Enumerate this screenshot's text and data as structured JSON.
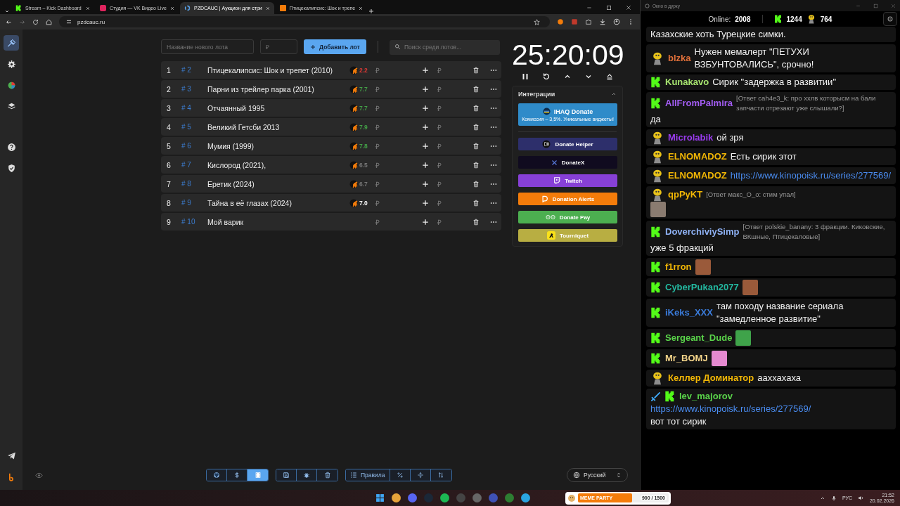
{
  "browser": {
    "tabs": [
      {
        "title": "Stream – Kick Dashboard",
        "kind": "kick",
        "selected": false
      },
      {
        "title": "Студия — VK Видео Live",
        "kind": "vk",
        "selected": false
      },
      {
        "title": "PZDCAUC | Аукцион для стри",
        "kind": "ring",
        "selected": true
      },
      {
        "title": "Птицекалипсис: Шок и трепе",
        "kind": "film",
        "selected": false
      }
    ],
    "address": "pzdcauc.ru"
  },
  "sidebar": {
    "items": [
      {
        "kind": "auction",
        "selected": true
      },
      {
        "kind": "settings",
        "selected": false
      },
      {
        "kind": "chart",
        "selected": false
      },
      {
        "kind": "layers",
        "selected": false
      },
      {
        "kind": "help",
        "selected": false
      },
      {
        "kind": "shield",
        "selected": false
      },
      {
        "kind": "telegram",
        "selected": false
      },
      {
        "kind": "logo",
        "selected": false
      }
    ]
  },
  "lot_form": {
    "name_placeholder": "Название нового лота",
    "amount_placeholder": "₽",
    "add_button": "Добавить лот",
    "search_placeholder": "Поиск среди лотов..."
  },
  "lots": [
    {
      "index": "1",
      "id": "# 2",
      "name": "Птицекалипсис: Шок и трепет (2010)",
      "rating": {
        "text": "2.2",
        "color": "#e53935"
      },
      "amount": "₽",
      "add_amount": "₽"
    },
    {
      "index": "2",
      "id": "# 3",
      "name": "Парни из трейлер парка (2001)",
      "rating": {
        "text": "7.7",
        "color": "#43a047"
      },
      "amount": "₽",
      "add_amount": "₽"
    },
    {
      "index": "3",
      "id": "# 4",
      "name": "Отчаянный 1995",
      "rating": {
        "text": "7.7",
        "color": "#43a047"
      },
      "amount": "₽",
      "add_amount": "₽"
    },
    {
      "index": "4",
      "id": "# 5",
      "name": "Великий Гетсби 2013",
      "rating": {
        "text": "7.9",
        "color": "#43a047"
      },
      "amount": "₽",
      "add_amount": "₽"
    },
    {
      "index": "5",
      "id": "# 6",
      "name": "Мумия (1999)",
      "rating": {
        "text": "7.8",
        "color": "#43a047"
      },
      "amount": "₽",
      "add_amount": "₽"
    },
    {
      "index": "6",
      "id": "# 7",
      "name": "Кислород (2021),",
      "rating": {
        "text": "6.5",
        "color": "#777777"
      },
      "amount": "₽",
      "add_amount": "₽"
    },
    {
      "index": "7",
      "id": "# 8",
      "name": "Еретик (2024)",
      "rating": {
        "text": "6.7",
        "color": "#777777"
      },
      "amount": "₽",
      "add_amount": "₽"
    },
    {
      "index": "8",
      "id": "# 9",
      "name": "Тайна в её глазах (2024)",
      "rating": {
        "text": "7.0",
        "color": "#ffffff"
      },
      "amount": "₽",
      "add_amount": "₽"
    },
    {
      "index": "9",
      "id": "# 10",
      "name": "Мой варик",
      "amount": "₽",
      "add_amount": "₽"
    }
  ],
  "timer": "25:20:09",
  "integrations": {
    "title": "Интеграции",
    "expanded": true,
    "items": [
      {
        "kind": "promo",
        "label": "IHAQ Donate",
        "subtitle": "Комиссия – 3,5%. Уникальные виджеты!",
        "color": "#2f8bc9"
      },
      {
        "kind": "helper",
        "label": "Donate Helper",
        "color": "#2d2f6b"
      },
      {
        "kind": "x",
        "label": "DonateX",
        "color": "#100b1f"
      },
      {
        "kind": "twitch",
        "label": "Twitch",
        "color": "#8740d6"
      },
      {
        "kind": "alerts",
        "label": "Donation Alerts",
        "color": "#f47c0a"
      },
      {
        "kind": "pay",
        "label": "Donate Pay",
        "color": "#4caf50"
      },
      {
        "kind": "tourniquet",
        "label": "Tourniquet",
        "color": "#b8ae42"
      }
    ]
  },
  "toolbar": {
    "groups": [
      [
        {
          "kind": "github",
          "selected": false
        },
        {
          "kind": "dollar",
          "selected": false
        },
        {
          "kind": "film",
          "selected": true
        }
      ],
      [
        {
          "kind": "save",
          "selected": false
        },
        {
          "kind": "bug",
          "selected": false
        },
        {
          "kind": "trash",
          "selected": false
        }
      ],
      [
        {
          "kind": "list",
          "label": "Правила",
          "selected": false
        },
        {
          "kind": "percent",
          "selected": false
        },
        {
          "kind": "split",
          "selected": false
        },
        {
          "kind": "sort",
          "selected": false
        }
      ]
    ]
  },
  "language": "Русский",
  "chat": {
    "title": "Окно в дурку",
    "online_label": "Online:",
    "online": "2008",
    "kick_count": "1244",
    "vk_count": "764",
    "messages": [
      {
        "text": "Казахские хоть Турецкие симки."
      },
      {
        "badges": [
          {
            "kind": "vk"
          }
        ],
        "user": "blzka",
        "color": "#e0703a",
        "text": "Нужен мемалерт \"ПЕТУХИ ВЗБУНТОВАЛИСЬ\", срочно!"
      },
      {
        "badges": [
          {
            "kind": "kick"
          }
        ],
        "user": "Kunakavo",
        "color": "#a6e36f",
        "text": "Сирик \"задержка в развитии\""
      },
      {
        "badges": [
          {
            "kind": "kick"
          }
        ],
        "user": "AllFromPalmira",
        "color": "#a25cf2",
        "reply": "[Ответ cah4e3_k: про ххлв которысм на бали запчасти отрезают уже слышали?]",
        "text": "да"
      },
      {
        "badges": [
          {
            "kind": "vk"
          }
        ],
        "user": "Microlabik",
        "color": "#9b3cf0",
        "text": "ой зря"
      },
      {
        "badges": [
          {
            "kind": "vk"
          }
        ],
        "user": "ELNOMADOZ",
        "color": "#f2b705",
        "text": "Есть сирик этот"
      },
      {
        "badges": [
          {
            "kind": "vk"
          }
        ],
        "user": "ELNOMADOZ",
        "color": "#f2b705",
        "link": "https://www.kinopoisk.ru/series/277569/"
      },
      {
        "badges": [
          {
            "kind": "vk"
          }
        ],
        "user": "qpPyKT",
        "color": "#f2b705",
        "reply": "[Ответ макс_O_o: стим упал]",
        "emote": {
          "kind": "statue"
        }
      },
      {
        "badges": [
          {
            "kind": "kick"
          }
        ],
        "user": "DoverchiviySimp",
        "color": "#8fb2f5",
        "reply": "[Ответ polskie_banany: 3 фракции. Киковские, ВКшные, Птицекаловые]",
        "text": "уже 5 фракций"
      },
      {
        "badges": [
          {
            "kind": "kick"
          }
        ],
        "user": "f1rron",
        "color": "#f2b705",
        "emote": {
          "kind": "photo"
        }
      },
      {
        "badges": [
          {
            "kind": "kick"
          }
        ],
        "user": "CyberPukan2077",
        "color": "#23b8a0",
        "emote": {
          "kind": "photo"
        }
      },
      {
        "badges": [
          {
            "kind": "kick"
          }
        ],
        "user": "iKeks_XXX",
        "color": "#3b7ddd",
        "text": "там походу название сериала \"замедленное развитие\""
      },
      {
        "badges": [
          {
            "kind": "kick"
          }
        ],
        "user": "Sergeant_Dude",
        "color": "#5ad44a",
        "emote": {
          "kind": "frog"
        }
      },
      {
        "badges": [
          {
            "kind": "kick"
          }
        ],
        "user": "Mr_BOMJ",
        "color": "#f5d58a",
        "emote": {
          "kind": "creature"
        }
      },
      {
        "badges": [
          {
            "kind": "vk"
          }
        ],
        "user": "Келлер Доминатор",
        "color": "#f2b705",
        "text": "ааххахаха"
      },
      {
        "badges": [
          {
            "kind": "sword"
          },
          {
            "kind": "kick"
          }
        ],
        "user": "lev_majorov",
        "color": "#5ad44a",
        "link": "https://www.kinopoisk.ru/series/277569/",
        "text": "вот тот сирик"
      }
    ]
  },
  "taskbar": {
    "meme_party": {
      "title": "MEME PARTY",
      "reading": "900 / 1500",
      "level": 0.6
    },
    "language": "РУС",
    "time": "21:52",
    "date": "20.02.2026"
  }
}
